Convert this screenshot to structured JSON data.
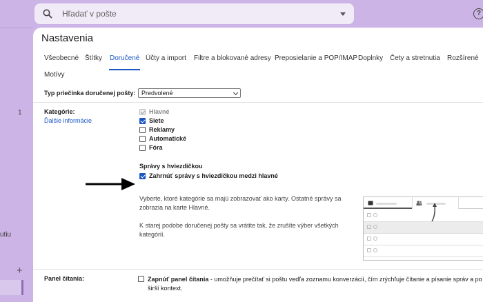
{
  "search": {
    "placeholder": "Hľadať v pošte"
  },
  "left": {
    "count": "1",
    "fragment": "utiu",
    "plus": "+"
  },
  "help": {
    "glyph": "?"
  },
  "page": {
    "title": "Nastavenia"
  },
  "tabs": [
    "Všeobecné",
    "Štítky",
    "Doručené",
    "Účty a import",
    "Filtre a blokované adresy",
    "Preposielanie a POP/IMAP",
    "Doplnky",
    "Čety a stretnutia",
    "Rozšírené",
    "Motívy"
  ],
  "active_tab": "Doručené",
  "inbox_type": {
    "label": "Typ priečinka doručenej pošty:",
    "value": "Predvolené"
  },
  "categories": {
    "label": "Kategórie:",
    "learn_more": "Ďalšie informácie",
    "items": [
      {
        "label": "Hlavné",
        "checked": true,
        "disabled": true
      },
      {
        "label": "Siete",
        "checked": true,
        "disabled": false
      },
      {
        "label": "Reklamy",
        "checked": false,
        "disabled": false
      },
      {
        "label": "Automatické",
        "checked": false,
        "disabled": false
      },
      {
        "label": "Fóra",
        "checked": false,
        "disabled": false
      }
    ],
    "starred_heading": "Správy s hviezdičkou",
    "starred_option": "Zahrnúť správy s hviezdičkou medzi hlavné",
    "info1_line1": "Vyberte, ktoré kategórie sa majú zobrazovať ako karty. Ostatné správy sa",
    "info1_line2": "zobrazia na karte Hlavné.",
    "info2_line1": "K starej podobe doručenej pošty sa vrátite tak, že zrušíte výber všetkých",
    "info2_line2": "kategórií."
  },
  "reading_pane": {
    "label": "Panel čítania:",
    "option_bold": "Zapnúť panel čítania",
    "option_rest": " - umožňuje prečítať si poštu vedľa zoznamu konverzácií, čím zrýchľuje čítanie a písanie správ a po",
    "line2": "širší kontext."
  },
  "colors": {
    "accent": "#1a57c4",
    "background": "#cdb4e6"
  }
}
